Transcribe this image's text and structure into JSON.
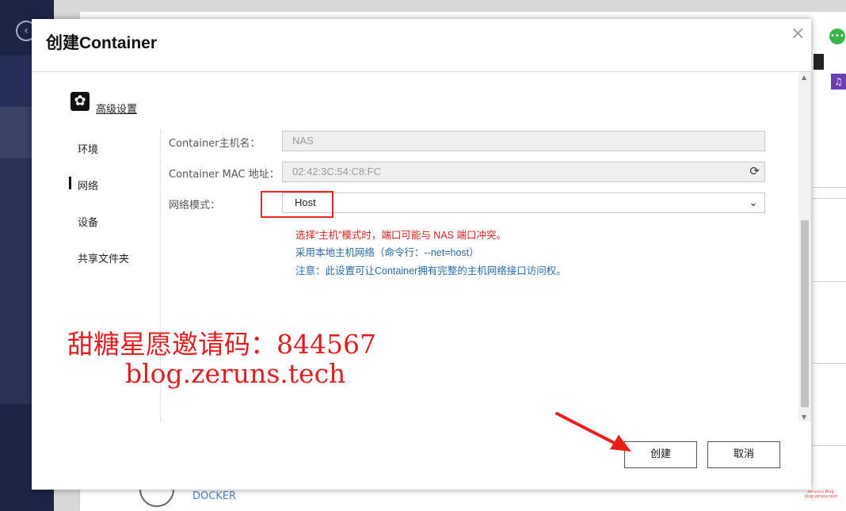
{
  "background": {
    "docker_label": "DOCKER",
    "watermark_small": "zeruns's Blog blog.zeruns.tech"
  },
  "dialog": {
    "title": "创建Container",
    "close": "×",
    "advanced_label": "高级设置",
    "nav": [
      {
        "label": "环境",
        "active": false
      },
      {
        "label": "网络",
        "active": true
      },
      {
        "label": "设备",
        "active": false
      },
      {
        "label": "共享文件夹",
        "active": false
      }
    ],
    "fields": {
      "hostname": {
        "label": "Container主机名：",
        "value": "NAS"
      },
      "mac": {
        "label": "Container MAC 地址：",
        "value": "02:42:3C:54:C8:FC"
      },
      "network_mode": {
        "label": "网络模式：",
        "value": "Host"
      }
    },
    "notes": {
      "warning": "选择“主机”模式时，端口可能与 NAS 端口冲突。",
      "info1": "采用本地主机网络（命令行：--net=host）",
      "info2": "注意：此设置可让Container拥有完整的主机网络接口访问权。"
    },
    "buttons": {
      "create": "创建",
      "cancel": "取消"
    }
  },
  "overlay": {
    "watermark_line1": "甜糖星愿邀请码：844567",
    "watermark_line2": "blog.zeruns.tech"
  },
  "colors": {
    "accent_red": "#e02020",
    "info_blue": "#2769a8"
  }
}
